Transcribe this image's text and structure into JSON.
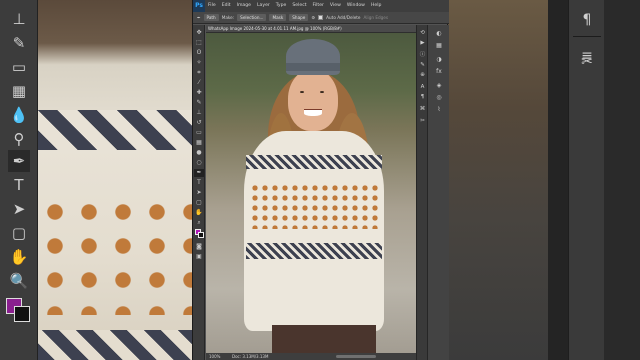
{
  "app": {
    "logo": "Ps",
    "menu": [
      "File",
      "Edit",
      "Image",
      "Layer",
      "Type",
      "Select",
      "Filter",
      "View",
      "Window",
      "Help"
    ]
  },
  "options_bar": {
    "mode": "Path",
    "make_label": "Make:",
    "selection_btn": "Selection...",
    "mask_btn": "Mask",
    "shape_btn": "Shape",
    "auto_add_delete": "Auto Add/Delete",
    "align_edges": "Align Edges"
  },
  "document": {
    "tab_title": "WhatsApp Image 2024-05-30 at 4.01.11 AM.jpg @ 100% (RGB/8#)",
    "zoom": "100%",
    "doc_size": "Doc: 3.13M/3.13M"
  },
  "colors": {
    "foreground": "#b019b6",
    "background": "#111111",
    "ps_blue": "#31a8ff"
  },
  "icons": {
    "left_big": [
      "stamp-icon",
      "history-brush-icon",
      "eraser-icon",
      "gradient-icon",
      "blur-icon",
      "dodge-icon",
      "pen-icon",
      "type-icon",
      "path-select-icon",
      "shape-icon",
      "hand-icon",
      "zoom-icon"
    ],
    "right_big": [
      "paragraph-icon",
      "brush-settings-icon",
      "tools-icon"
    ]
  }
}
